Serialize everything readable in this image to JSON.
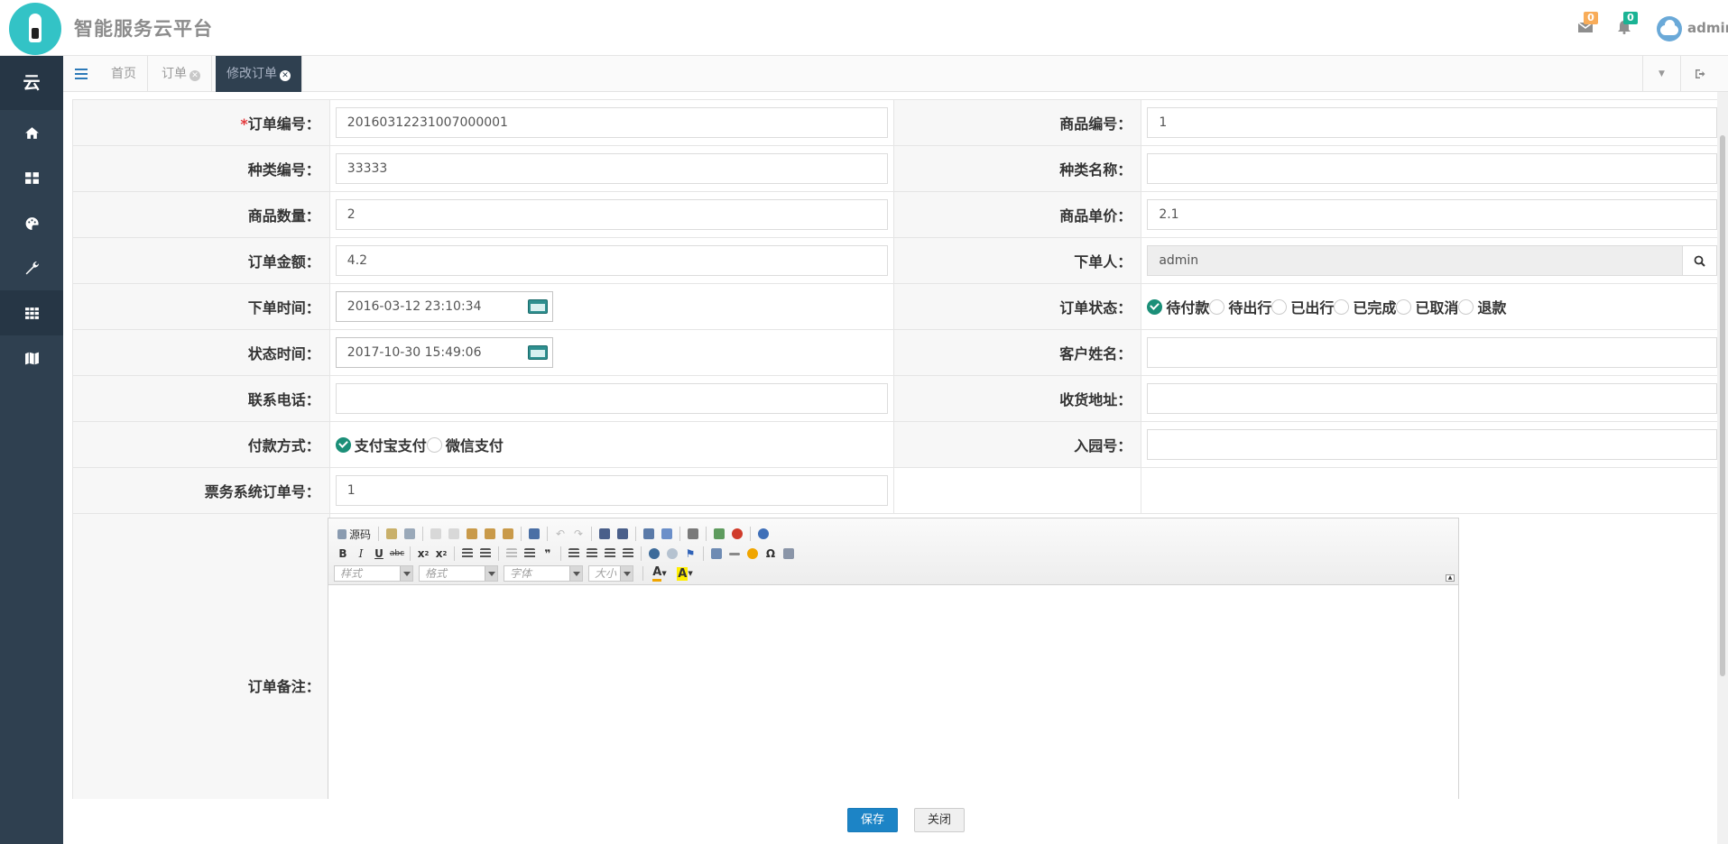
{
  "header": {
    "title": "智能服务云平台",
    "messages_count": "0",
    "notifications_count": "0",
    "user_name": "admin",
    "colors": {
      "badge_orange": "#f8ac59",
      "badge_teal": "#1ab394",
      "logo_bg": "#33c3c6"
    }
  },
  "sidebar": {
    "head_label": "云",
    "items": [
      {
        "icon": "home-icon"
      },
      {
        "icon": "dashboard-grid-icon"
      },
      {
        "icon": "palette-icon"
      },
      {
        "icon": "wrench-icon"
      },
      {
        "icon": "table-grid-icon",
        "active": true
      },
      {
        "icon": "map-icon"
      }
    ],
    "bg_color": "#2f4050"
  },
  "tabs": [
    {
      "label": "首页"
    },
    {
      "label": "订单"
    },
    {
      "label": "修改订单",
      "active": true
    }
  ],
  "form": {
    "order_no_label": "订单编号：",
    "order_no_value": "20160312231007000001",
    "goods_no_label": "商品编号：",
    "goods_no_value": "1",
    "category_no_label": "种类编号：",
    "category_no_value": "33333",
    "category_name_label": "种类名称：",
    "category_name_value": "",
    "quantity_label": "商品数量：",
    "quantity_value": "2",
    "unit_price_label": "商品单价：",
    "unit_price_value": "2.1",
    "amount_label": "订单金额：",
    "amount_value": "4.2",
    "orderer_label": "下单人：",
    "orderer_value": "admin",
    "order_time_label": "下单时间：",
    "order_time_value": "2016-03-12 23:10:34",
    "status_label": "订单状态：",
    "status_options": [
      "待付款",
      "待出行",
      "已出行",
      "已完成",
      "已取消",
      "退款"
    ],
    "status_selected": "待付款",
    "status_time_label": "状态时间：",
    "status_time_value": "2017-10-30 15:49:06",
    "customer_name_label": "客户姓名：",
    "customer_name_value": "",
    "phone_label": "联系电话：",
    "phone_value": "",
    "address_label": "收货地址：",
    "address_value": "",
    "payment_label": "付款方式：",
    "payment_options": [
      "支付宝支付",
      "微信支付"
    ],
    "payment_selected": "支付宝支付",
    "park_no_label": "入园号：",
    "park_no_value": "",
    "ticket_order_label": "票务系统订单号：",
    "ticket_order_value": "1",
    "remark_label": "订单备注："
  },
  "editor": {
    "source_label": "源码",
    "combo_style": "样式",
    "combo_format": "格式",
    "combo_font": "字体",
    "combo_size": "大小"
  },
  "footer": {
    "save_label": "保存",
    "close_label": "关闭"
  }
}
